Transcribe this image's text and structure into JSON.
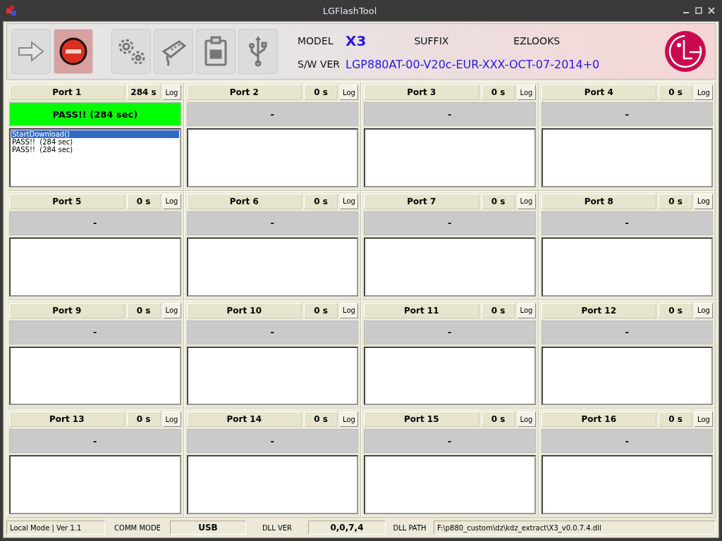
{
  "window": {
    "title": "LGFlashTool"
  },
  "toolbar_buttons": [
    {
      "kind": "start",
      "selected": false
    },
    {
      "kind": "stop",
      "selected": true
    },
    {
      "kind": "settings",
      "selected": false
    },
    {
      "kind": "serial",
      "selected": false
    },
    {
      "kind": "clipboard",
      "selected": false
    },
    {
      "kind": "usb",
      "selected": false
    }
  ],
  "info": {
    "model_label": "MODEL",
    "model": "X3",
    "suffix_label": "SUFFIX",
    "suffix": "EZLOOKS",
    "sw_ver_label": "S/W VER",
    "sw_ver": "LGP880AT-00-V20c-EUR-XXX-OCT-07-2014+0"
  },
  "ports": [
    {
      "name": "Port 1",
      "time": "284 s",
      "log_button": "Log",
      "status": "PASS!!  (284 sec)",
      "color": "#00ff00",
      "log": [
        {
          "text": "StartDownload()",
          "selected": true
        },
        {
          "text": "PASS!!  (284 sec)",
          "selected": false
        },
        {
          "text": "PASS!!  (284 sec)",
          "selected": false
        }
      ]
    },
    {
      "name": "Port 2",
      "time": "0 s",
      "log_button": "Log",
      "status": "-",
      "color": "#cacaca"
    },
    {
      "name": "Port 3",
      "time": "0 s",
      "log_button": "Log",
      "status": "-",
      "color": "#cacaca"
    },
    {
      "name": "Port 4",
      "time": "0 s",
      "log_button": "Log",
      "status": "-",
      "color": "#cacaca"
    },
    {
      "name": "Port 5",
      "time": "0 s",
      "log_button": "Log",
      "status": "-",
      "color": "#cacaca"
    },
    {
      "name": "Port 6",
      "time": "0 s",
      "log_button": "Log",
      "status": "-",
      "color": "#cacaca"
    },
    {
      "name": "Port 7",
      "time": "0 s",
      "log_button": "Log",
      "status": "-",
      "color": "#cacaca"
    },
    {
      "name": "Port 8",
      "time": "0 s",
      "log_button": "Log",
      "status": "-",
      "color": "#cacaca"
    },
    {
      "name": "Port 9",
      "time": "0 s",
      "log_button": "Log",
      "status": "-",
      "color": "#cacaca"
    },
    {
      "name": "Port 10",
      "time": "0 s",
      "log_button": "Log",
      "status": "-",
      "color": "#cacaca"
    },
    {
      "name": "Port 11",
      "time": "0 s",
      "log_button": "Log",
      "status": "-",
      "color": "#cacaca"
    },
    {
      "name": "Port 12",
      "time": "0 s",
      "log_button": "Log",
      "status": "-",
      "color": "#cacaca"
    },
    {
      "name": "Port 13",
      "time": "0 s",
      "log_button": "Log",
      "status": "-",
      "color": "#cacaca"
    },
    {
      "name": "Port 14",
      "time": "0 s",
      "log_button": "Log",
      "status": "-",
      "color": "#cacaca"
    },
    {
      "name": "Port 15",
      "time": "0 s",
      "log_button": "Log",
      "status": "-",
      "color": "#cacaca"
    },
    {
      "name": "Port 16",
      "time": "0 s",
      "log_button": "Log",
      "status": "-",
      "color": "#cacaca"
    }
  ],
  "status_bar": {
    "mode": "Local Mode | Ver 1.1",
    "comm_mode_label": "COMM MODE",
    "comm_mode": "USB",
    "dll_ver_label": "DLL VER",
    "dll_ver": "0,0,7,4",
    "dll_path_label": "DLL PATH",
    "dll_path": "F:\\p880_custom\\dz\\kdz_extract\\X3_v0.0.7.4.dll"
  }
}
